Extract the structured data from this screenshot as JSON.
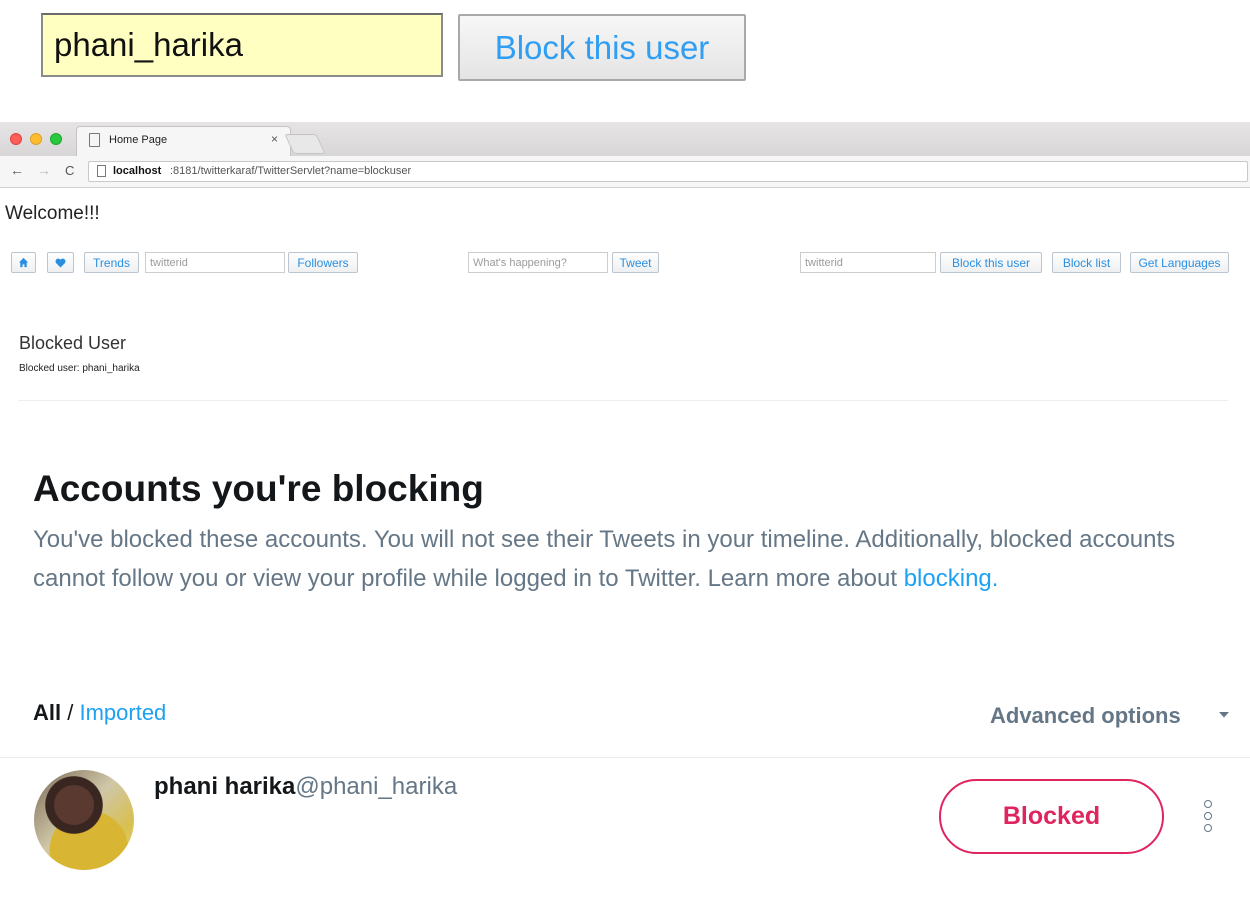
{
  "zoom": {
    "input_value": "phani_harika",
    "button_label": "Block this user"
  },
  "browser": {
    "tab_title": "Home Page",
    "tab_close": "×",
    "back": "←",
    "forward": "→",
    "reload": "C",
    "url_host": "localhost",
    "url_rest": ":8181/twitterkaraf/TwitterServlet?name=blockuser"
  },
  "app": {
    "welcome": "Welcome!!!",
    "home_icon": "home-icon",
    "heart_icon": "heart-icon",
    "trends_label": "Trends",
    "followers_placeholder": "twitterid",
    "followers_label": "Followers",
    "tweet_placeholder": "What's happening?",
    "tweet_label": "Tweet",
    "block_placeholder": "twitterid",
    "block_label": "Block this user",
    "blocklist_label": "Block list",
    "languages_label": "Get Languages",
    "result_title": "Blocked User",
    "result_text": "Blocked user: phani_harika"
  },
  "twitter": {
    "heading": "Accounts you're blocking",
    "description": "You've blocked these accounts. You will not see their Tweets in your timeline. Additionally, blocked accounts cannot follow you or view your profile while logged in to Twitter. Learn more about ",
    "learn_link": "blocking.",
    "filter_all": "All",
    "filter_sep": " / ",
    "filter_imported": "Imported",
    "advanced_options": "Advanced options",
    "accounts": [
      {
        "name": "phani harika",
        "handle": "@phani_harika",
        "button": "Blocked"
      }
    ]
  },
  "colors": {
    "twitter_blue": "#1da1f2",
    "blocked_red": "#e0245e",
    "muted_gray": "#657786",
    "input_yellow": "#ffffc2"
  }
}
